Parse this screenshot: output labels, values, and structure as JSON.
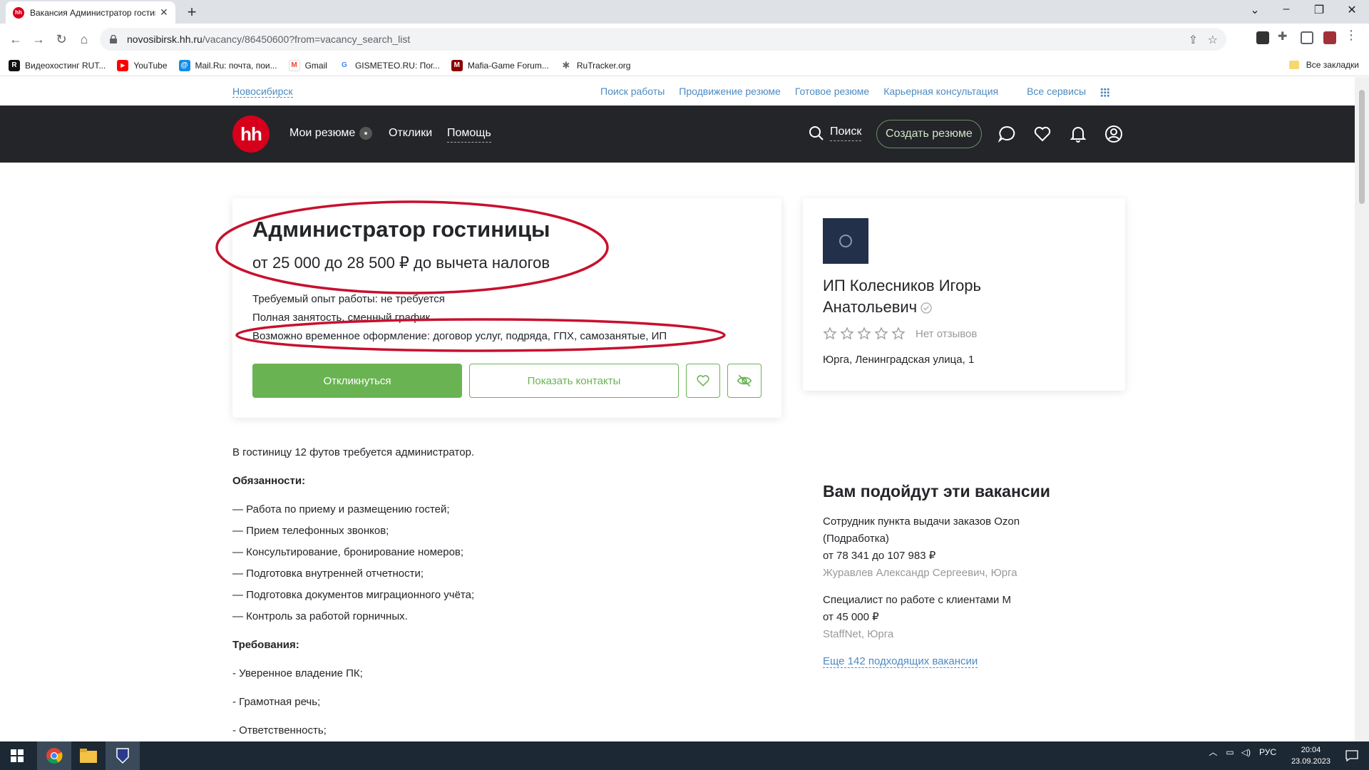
{
  "browser": {
    "tab_title": "Вакансия Администратор гостини",
    "tab_favicon": "hh",
    "url_host": "novosibirsk.hh.ru",
    "url_path": "/vacancy/86450600?from=vacancy_search_list",
    "bookmarks": [
      {
        "label": "Видеохостинг RUT...",
        "icon": "R",
        "color": "#111111"
      },
      {
        "label": "YouTube",
        "icon": "▶",
        "color": "#ff0000"
      },
      {
        "label": "Mail.Ru: почта, пои...",
        "icon": "@",
        "color": "#168de2"
      },
      {
        "label": "Gmail",
        "icon": "M",
        "color": "#ea4335"
      },
      {
        "label": "GISMETEO.RU: Пог...",
        "icon": "G",
        "color": "#4285f4"
      },
      {
        "label": "Mafia-Game Forum...",
        "icon": "M",
        "color": "#8b0000"
      },
      {
        "label": "RuTracker.org",
        "icon": "✱",
        "color": "#6a6a6a"
      }
    ],
    "all_bookmarks": "Все закладки"
  },
  "subnav": {
    "city": "Новосибирск",
    "links": [
      "Поиск работы",
      "Продвижение резюме",
      "Готовое резюме",
      "Карьерная консультация",
      "Все сервисы"
    ]
  },
  "header": {
    "logo": "hh",
    "nav": {
      "resumes": "Мои резюме",
      "responses": "Отклики",
      "help": "Помощь"
    },
    "search": "Поиск",
    "create_resume": "Создать резюме"
  },
  "vacancy": {
    "title": "Администратор гостиницы",
    "salary": "от 25 000 до 28 500 ₽ до вычета налогов",
    "experience": "Требуемый опыт работы: не требуется",
    "employment": "Полная занятость, сменный график",
    "temporary": "Возможно временное оформление: договор услуг, подряда, ГПХ, самозанятые, ИП",
    "apply_button": "Откликнуться",
    "contacts_button": "Показать контакты"
  },
  "employer": {
    "name_line1": "ИП Колесников Игорь",
    "name_line2": "Анатольевич",
    "reviews": "Нет отзывов",
    "rating": 0,
    "address": "Юрга, Ленинградская улица, 1"
  },
  "description": {
    "intro": "В гостиницу 12 футов требуется администратор.",
    "duties_title": "Обязанности:",
    "duties": [
      "— Работа по приему и размещению гостей;",
      "— Прием телефонных звонков;",
      "— Консультирование, бронирование номеров;",
      "— Подготовка внутренней отчетности;",
      "— Подготовка документов миграционного учёта;",
      "— Контроль за работой горничных."
    ],
    "requirements_title": "Требования:",
    "requirements": [
      "- Уверенное владение ПК;",
      "- Грамотная речь;",
      "- Ответственность;"
    ]
  },
  "similar": {
    "title": "Вам подойдут эти вакансии",
    "items": [
      {
        "title_line1": "Сотрудник пункта выдачи заказов Ozon",
        "title_line2": "(Подработка)",
        "salary": "от 78 341 до 107 983 ₽",
        "company": "Журавлев Александр Сергеевич, Юрга"
      },
      {
        "title_line1": "Специалист по работе с клиентами М",
        "salary": "от 45 000 ₽",
        "company": "StaffNet, Юрга"
      }
    ],
    "more": "Еще 142 подходящих вакансии"
  },
  "taskbar": {
    "lang": "РУС",
    "time": "20:04",
    "date": "23.09.2023"
  },
  "colors": {
    "brand_red": "#d6001c",
    "header_dark": "#232529",
    "accent_green": "#6ab353",
    "link_blue": "#4c8bc2",
    "annotation_red": "#c8102e"
  }
}
